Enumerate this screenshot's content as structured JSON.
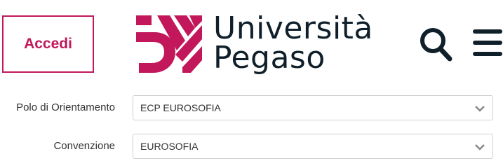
{
  "header": {
    "login_label": "Accedi",
    "logo_line1": "Università",
    "logo_line2": "Pegaso",
    "search_icon": "search-icon",
    "menu_icon": "hamburger-menu-icon"
  },
  "form": {
    "polo": {
      "label": "Polo di Orientamento",
      "selected": "ECP EUROSOFIA"
    },
    "convenzione": {
      "label": "Convenzione",
      "selected": "EUROSOFIA"
    }
  },
  "colors": {
    "brand": "#c2185b",
    "text_dark": "#10202b",
    "border": "#cfcfcf"
  }
}
